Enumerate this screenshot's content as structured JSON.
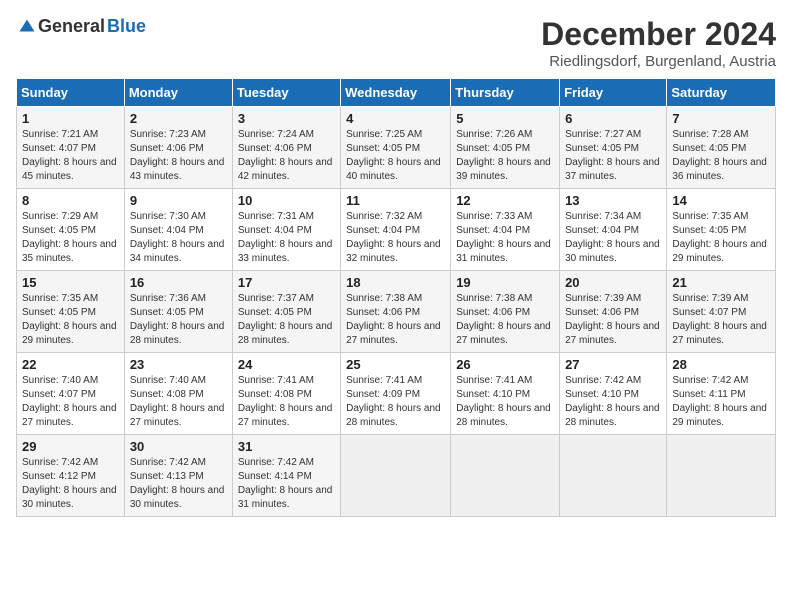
{
  "logo": {
    "general": "General",
    "blue": "Blue"
  },
  "title": "December 2024",
  "location": "Riedlingsdorf, Burgenland, Austria",
  "days_of_week": [
    "Sunday",
    "Monday",
    "Tuesday",
    "Wednesday",
    "Thursday",
    "Friday",
    "Saturday"
  ],
  "weeks": [
    [
      {
        "day": "1",
        "sunrise": "7:21 AM",
        "sunset": "4:07 PM",
        "daylight": "8 hours and 45 minutes."
      },
      {
        "day": "2",
        "sunrise": "7:23 AM",
        "sunset": "4:06 PM",
        "daylight": "8 hours and 43 minutes."
      },
      {
        "day": "3",
        "sunrise": "7:24 AM",
        "sunset": "4:06 PM",
        "daylight": "8 hours and 42 minutes."
      },
      {
        "day": "4",
        "sunrise": "7:25 AM",
        "sunset": "4:05 PM",
        "daylight": "8 hours and 40 minutes."
      },
      {
        "day": "5",
        "sunrise": "7:26 AM",
        "sunset": "4:05 PM",
        "daylight": "8 hours and 39 minutes."
      },
      {
        "day": "6",
        "sunrise": "7:27 AM",
        "sunset": "4:05 PM",
        "daylight": "8 hours and 37 minutes."
      },
      {
        "day": "7",
        "sunrise": "7:28 AM",
        "sunset": "4:05 PM",
        "daylight": "8 hours and 36 minutes."
      }
    ],
    [
      {
        "day": "8",
        "sunrise": "7:29 AM",
        "sunset": "4:05 PM",
        "daylight": "8 hours and 35 minutes."
      },
      {
        "day": "9",
        "sunrise": "7:30 AM",
        "sunset": "4:04 PM",
        "daylight": "8 hours and 34 minutes."
      },
      {
        "day": "10",
        "sunrise": "7:31 AM",
        "sunset": "4:04 PM",
        "daylight": "8 hours and 33 minutes."
      },
      {
        "day": "11",
        "sunrise": "7:32 AM",
        "sunset": "4:04 PM",
        "daylight": "8 hours and 32 minutes."
      },
      {
        "day": "12",
        "sunrise": "7:33 AM",
        "sunset": "4:04 PM",
        "daylight": "8 hours and 31 minutes."
      },
      {
        "day": "13",
        "sunrise": "7:34 AM",
        "sunset": "4:04 PM",
        "daylight": "8 hours and 30 minutes."
      },
      {
        "day": "14",
        "sunrise": "7:35 AM",
        "sunset": "4:05 PM",
        "daylight": "8 hours and 29 minutes."
      }
    ],
    [
      {
        "day": "15",
        "sunrise": "7:35 AM",
        "sunset": "4:05 PM",
        "daylight": "8 hours and 29 minutes."
      },
      {
        "day": "16",
        "sunrise": "7:36 AM",
        "sunset": "4:05 PM",
        "daylight": "8 hours and 28 minutes."
      },
      {
        "day": "17",
        "sunrise": "7:37 AM",
        "sunset": "4:05 PM",
        "daylight": "8 hours and 28 minutes."
      },
      {
        "day": "18",
        "sunrise": "7:38 AM",
        "sunset": "4:06 PM",
        "daylight": "8 hours and 27 minutes."
      },
      {
        "day": "19",
        "sunrise": "7:38 AM",
        "sunset": "4:06 PM",
        "daylight": "8 hours and 27 minutes."
      },
      {
        "day": "20",
        "sunrise": "7:39 AM",
        "sunset": "4:06 PM",
        "daylight": "8 hours and 27 minutes."
      },
      {
        "day": "21",
        "sunrise": "7:39 AM",
        "sunset": "4:07 PM",
        "daylight": "8 hours and 27 minutes."
      }
    ],
    [
      {
        "day": "22",
        "sunrise": "7:40 AM",
        "sunset": "4:07 PM",
        "daylight": "8 hours and 27 minutes."
      },
      {
        "day": "23",
        "sunrise": "7:40 AM",
        "sunset": "4:08 PM",
        "daylight": "8 hours and 27 minutes."
      },
      {
        "day": "24",
        "sunrise": "7:41 AM",
        "sunset": "4:08 PM",
        "daylight": "8 hours and 27 minutes."
      },
      {
        "day": "25",
        "sunrise": "7:41 AM",
        "sunset": "4:09 PM",
        "daylight": "8 hours and 28 minutes."
      },
      {
        "day": "26",
        "sunrise": "7:41 AM",
        "sunset": "4:10 PM",
        "daylight": "8 hours and 28 minutes."
      },
      {
        "day": "27",
        "sunrise": "7:42 AM",
        "sunset": "4:10 PM",
        "daylight": "8 hours and 28 minutes."
      },
      {
        "day": "28",
        "sunrise": "7:42 AM",
        "sunset": "4:11 PM",
        "daylight": "8 hours and 29 minutes."
      }
    ],
    [
      {
        "day": "29",
        "sunrise": "7:42 AM",
        "sunset": "4:12 PM",
        "daylight": "8 hours and 30 minutes."
      },
      {
        "day": "30",
        "sunrise": "7:42 AM",
        "sunset": "4:13 PM",
        "daylight": "8 hours and 30 minutes."
      },
      {
        "day": "31",
        "sunrise": "7:42 AM",
        "sunset": "4:14 PM",
        "daylight": "8 hours and 31 minutes."
      },
      null,
      null,
      null,
      null
    ]
  ],
  "labels": {
    "sunrise": "Sunrise:",
    "sunset": "Sunset:",
    "daylight": "Daylight:"
  }
}
